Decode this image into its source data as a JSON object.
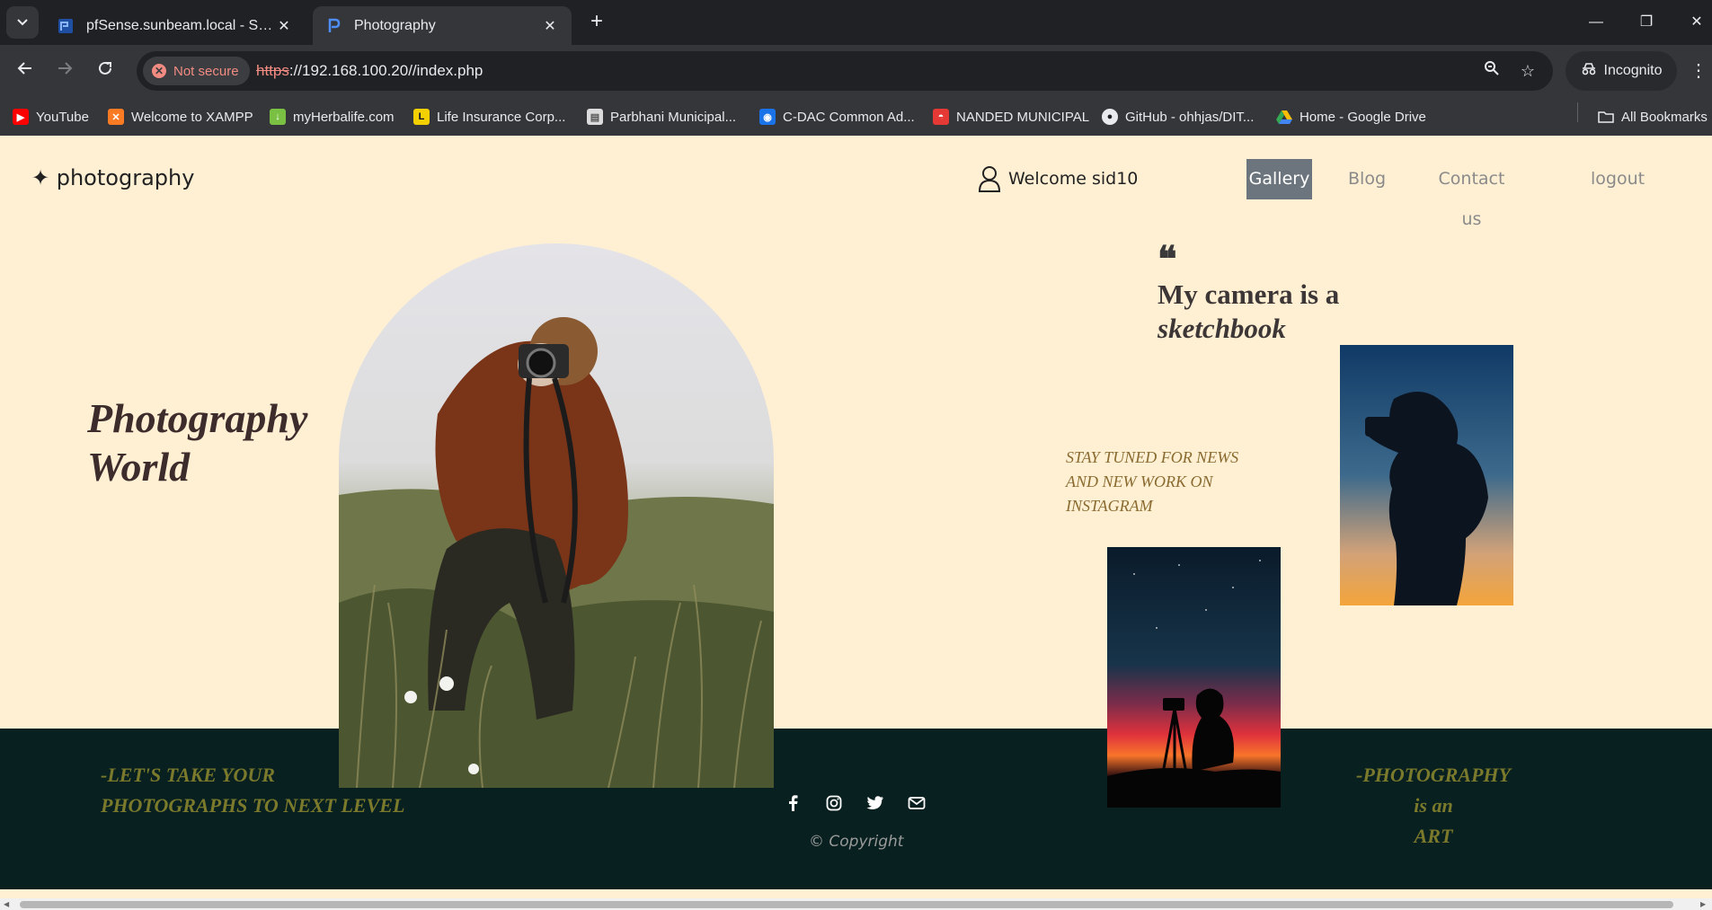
{
  "browser": {
    "tabs": [
      {
        "title": "pfSense.sunbeam.local - Status",
        "icon": "pfsense-icon",
        "active": false
      },
      {
        "title": "Photography",
        "icon": "photography-favicon",
        "active": true
      }
    ],
    "security_chip": "Not secure",
    "url_scheme": "https",
    "url_rest": "://192.168.100.20//index.php",
    "incognito_label": "Incognito",
    "bookmarks": [
      {
        "label": "YouTube",
        "icon": "youtube-icon",
        "color": "#ff0000"
      },
      {
        "label": "Welcome to XAMPP",
        "icon": "xampp-icon",
        "color": "#fb7a24"
      },
      {
        "label": "myHerbalife.com",
        "icon": "herbalife-icon",
        "color": "#7ac143"
      },
      {
        "label": "Life Insurance Corp...",
        "icon": "lic-icon",
        "color": "#f5d000"
      },
      {
        "label": "Parbhani Municipal...",
        "icon": "document-icon",
        "color": "#dcdcdc"
      },
      {
        "label": "C-DAC Common Ad...",
        "icon": "cdac-icon",
        "color": "#1a73e8"
      },
      {
        "label": "NANDED MUNICIPAL",
        "icon": "nanded-icon",
        "color": "#e53935"
      },
      {
        "label": "GitHub - ohhjas/DIT...",
        "icon": "github-icon",
        "color": "#ffffff"
      },
      {
        "label": "Home - Google Drive",
        "icon": "google-drive-icon",
        "color": "#34a853"
      }
    ],
    "all_bookmarks": "All Bookmarks"
  },
  "site": {
    "brand": "✦ photography",
    "welcome": "Welcome sid10",
    "nav": {
      "gallery": "Gallery",
      "blog": "Blog",
      "contact": "Contact us",
      "logout": "logout"
    },
    "hero_title_line1": "Photography",
    "hero_title_line2": "World",
    "quote_mark": "❝",
    "quote_line1": "My camera is a",
    "quote_line2": "sketchbook",
    "stay_tuned": "STAY TUNED FOR NEWS AND NEW WORK ON INSTAGRAM",
    "footer": {
      "left_line1": "-LET'S TAKE YOUR",
      "left_line2": "PHOTOGRAPHS TO NEXT LEVEL",
      "right_line1": "-PHOTOGRAPHY",
      "right_line2": "is an",
      "right_line3": "ART",
      "copyright": "© Copyright",
      "social_icons": [
        "facebook-icon",
        "instagram-icon",
        "twitter-icon",
        "envelope-icon"
      ]
    }
  },
  "colors": {
    "page_bg": "#fff0d4",
    "footer_bg": "#08201f",
    "footer_text": "#7b7a2c",
    "nav_active_bg": "#6c757d"
  }
}
